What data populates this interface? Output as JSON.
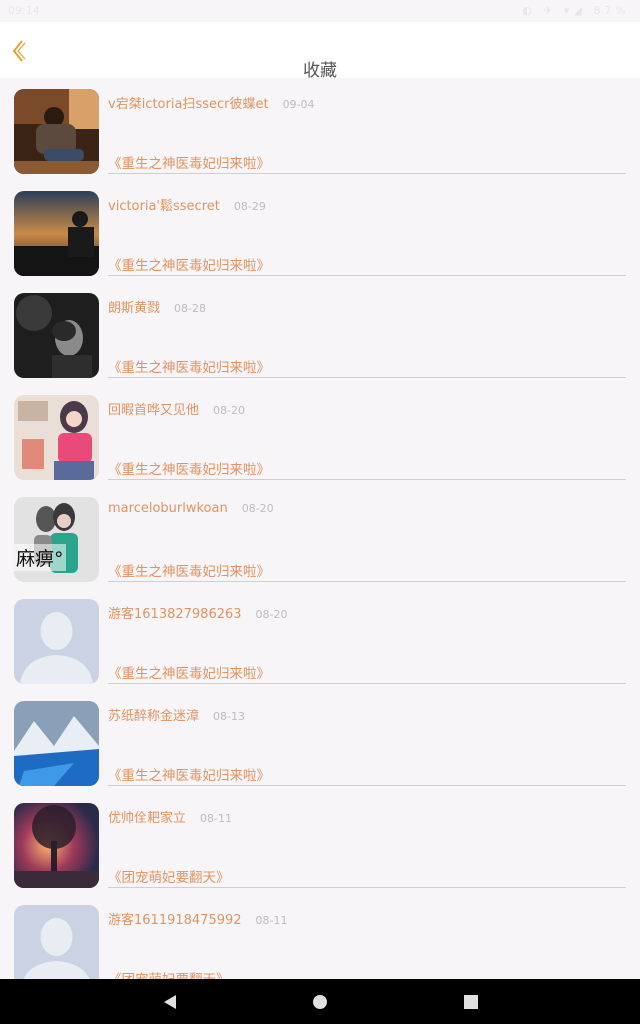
{
  "status": {
    "time": "09:14",
    "icons": "◐ ✈ ▾◢ 87%"
  },
  "header": {
    "title": "收藏"
  },
  "items": [
    {
      "name": "v宕桀ictoria扫ssecr彼蝶et",
      "date": "09-04",
      "book": "《重生之神医毒妃归来啦》",
      "avatar": "avatar-photo-sitting-man"
    },
    {
      "name": "victoria'鬆ssecret",
      "date": "08-29",
      "book": "《重生之神医毒妃归来啦》",
      "avatar": "avatar-photo-sunset-man"
    },
    {
      "name": "朗斯黄戮",
      "date": "08-28",
      "book": "《重生之神医毒妃归来啦》",
      "avatar": "avatar-photo-dark-portrait"
    },
    {
      "name": "回暇首哗又见他",
      "date": "08-20",
      "book": "《重生之神医毒妃归来啦》",
      "avatar": "avatar-illustration-girl"
    },
    {
      "name": "marceloburlwkoan",
      "date": "08-20",
      "book": "《重生之神医毒妃归来啦》",
      "avatar": "avatar-photo-couple"
    },
    {
      "name": "游客1613827986263",
      "date": "08-20",
      "book": "《重生之神医毒妃归来啦》",
      "avatar": "avatar-default"
    },
    {
      "name": "苏纸醉称金迷漳",
      "date": "08-13",
      "book": "《重生之神医毒妃归来啦》",
      "avatar": "avatar-photo-mountain-lake"
    },
    {
      "name": "优帅佺耙家立",
      "date": "08-11",
      "book": "《团宠萌妃要翻天》",
      "avatar": "avatar-photo-tree-sunset"
    },
    {
      "name": "游客1611918475992",
      "date": "08-11",
      "book": "《团宠萌妃要翻天》",
      "avatar": "avatar-default"
    }
  ],
  "overlay": {
    "text": "麻痹°"
  },
  "colors": {
    "accent": "#e4935f",
    "date": "#bdbdbd",
    "divider": "#cfcfcf",
    "background": "#f7f5f7"
  },
  "navbar": {
    "icons": [
      "back-triangle-icon",
      "home-circle-icon",
      "recents-square-icon"
    ]
  }
}
